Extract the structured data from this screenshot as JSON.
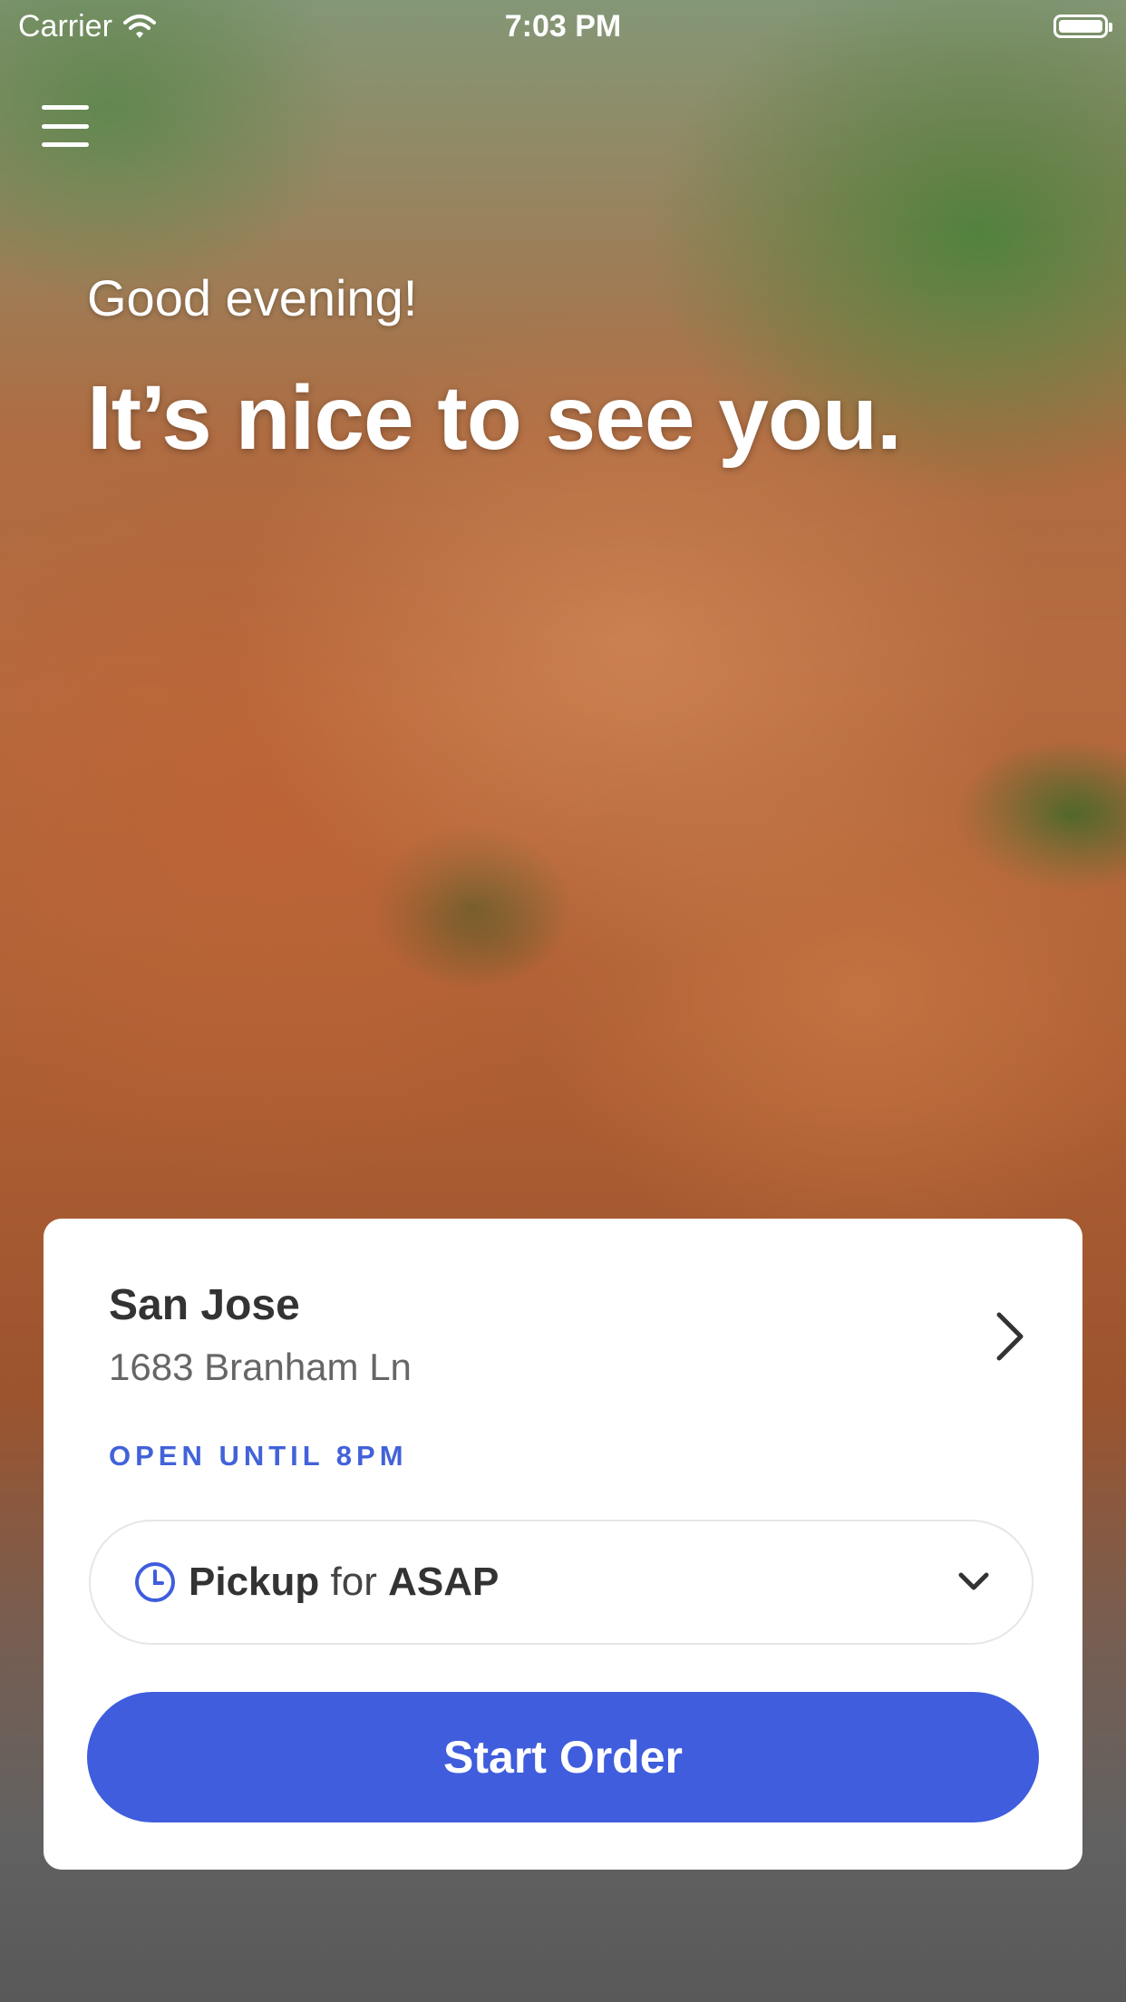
{
  "status_bar": {
    "carrier": "Carrier",
    "time": "7:03 PM"
  },
  "header": {
    "greeting": "Good evening!",
    "headline": "It’s nice to see you."
  },
  "location": {
    "name": "San Jose",
    "address": "1683 Branham Ln",
    "hours": "OPEN UNTIL 8PM"
  },
  "order_mode": {
    "mode": "Pickup",
    "connector": "for",
    "time": "ASAP"
  },
  "actions": {
    "start_order": "Start Order"
  },
  "colors": {
    "accent": "#3f5ddc",
    "hours_text": "#4262d8",
    "card_bg": "#ffffff"
  },
  "icons": {
    "menu": "hamburger-menu-icon",
    "location_arrow": "chevron-right-icon",
    "clock": "clock-icon",
    "dropdown": "chevron-down-icon"
  }
}
